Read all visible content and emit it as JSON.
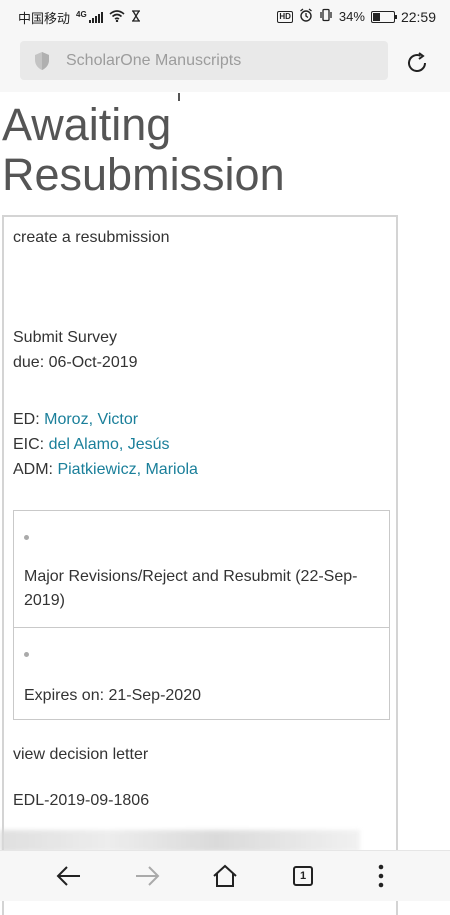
{
  "status_bar": {
    "carrier": "中国移动",
    "network": "4G",
    "battery": "34%",
    "battery_level": 0.34,
    "time": "22:59",
    "hd_label": "HD"
  },
  "browser": {
    "address_text": "ScholarOne Manuscripts"
  },
  "page": {
    "title": "Awaiting Resubmission",
    "create_link": "create a resubmission",
    "survey_link": "Submit Survey",
    "due_text": "due: 06-Oct-2019",
    "editors": [
      {
        "role": "ED:",
        "name": "Moroz, Victor"
      },
      {
        "role": "EIC:",
        "name": "del Alamo, Jesús"
      },
      {
        "role": "ADM:",
        "name": "Piatkiewicz, Mariola"
      }
    ],
    "decision": "Major Revisions/Reject and Resubmit (22-Sep-2019)",
    "expires": "Expires on: 21-Sep-2020",
    "decision_letter_link": "view decision letter",
    "letter_id": "EDL-2019-09-1806"
  },
  "nav": {
    "tab_count": "1"
  },
  "colors": {
    "link": "#1a7f9a",
    "title": "#555555"
  }
}
